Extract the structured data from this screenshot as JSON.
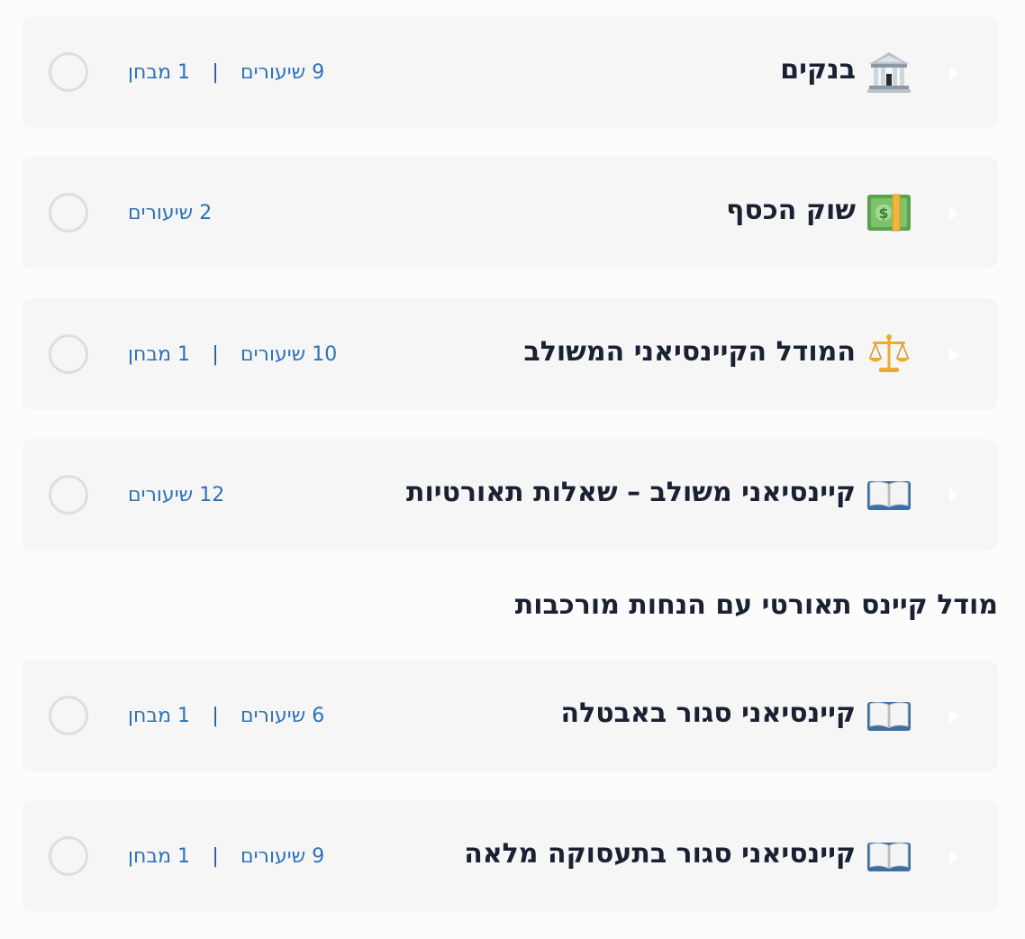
{
  "topics": [
    {
      "title": "בנקים",
      "icon": "bank-icon",
      "lessons": "9 שיעורים",
      "separator": "|",
      "exam": "1 מבחן"
    },
    {
      "title": "שוק הכסף",
      "icon": "banknote-icon",
      "lessons": "2 שיעורים"
    },
    {
      "title": "המודל הקיינסיאני המשולב",
      "icon": "scales-icon",
      "lessons": "10 שיעורים",
      "separator": "|",
      "exam": "1 מבחן"
    },
    {
      "title": "קיינסיאני משולב – שאלות תאורטיות",
      "icon": "open-book-icon",
      "lessons": "12 שיעורים"
    }
  ],
  "section": {
    "title": "מודל קיינס תאורטי עם הנחות מורכבות",
    "topics": [
      {
        "title": "קיינסיאני סגור באבטלה",
        "icon": "open-book-icon",
        "lessons": "6 שיעורים",
        "separator": "|",
        "exam": "1 מבחן"
      },
      {
        "title": "קיינסיאני סגור בתעסוקה מלאה",
        "icon": "open-book-icon",
        "lessons": "9 שיעורים",
        "separator": "|",
        "exam": "1 מבחן"
      }
    ]
  },
  "colors": {
    "card_bg": "#f6f6f6",
    "title": "#1a2133",
    "meta": "#2d72b8",
    "circle": "#dedede"
  }
}
